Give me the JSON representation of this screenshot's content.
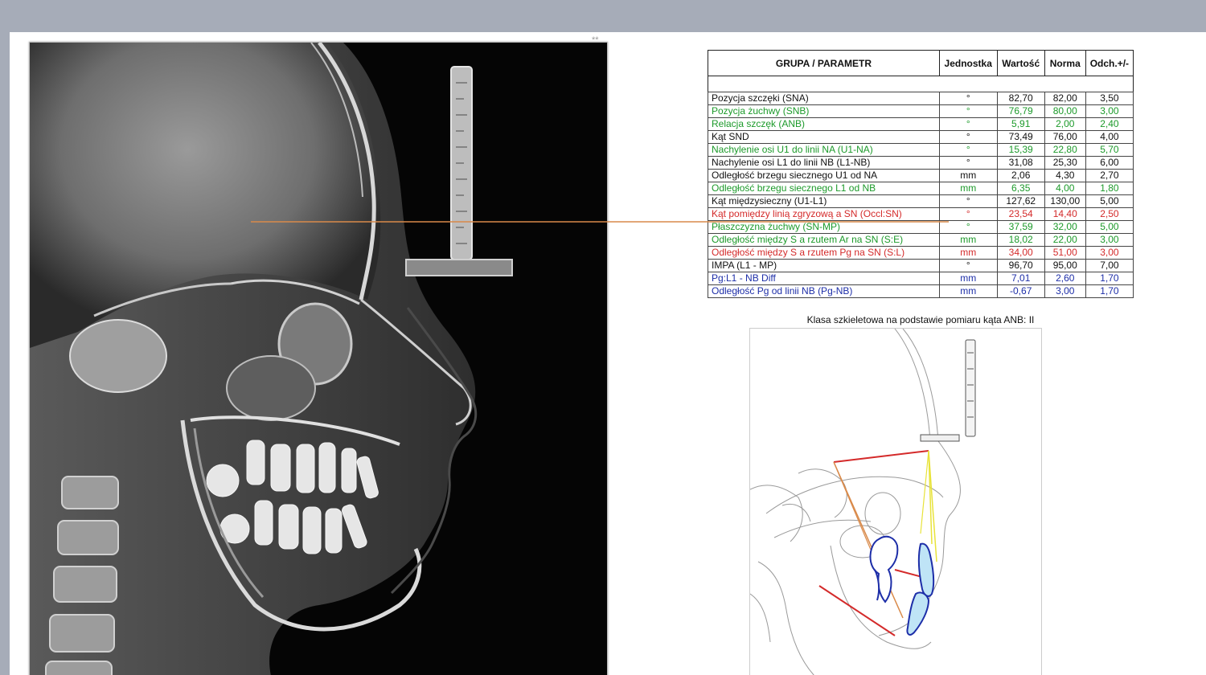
{
  "corner_mark": "**",
  "table": {
    "headers": [
      "GRUPA / PARAMETR",
      "Jednostka",
      "Wartość",
      "Norma",
      "Odch.+/-"
    ],
    "rows": [
      {
        "name": "Pozycja szczęki (SNA)",
        "unit": "°",
        "value": "82,70",
        "norm": "82,00",
        "dev": "3,50",
        "color": "black"
      },
      {
        "name": "Pozycja żuchwy (SNB)",
        "unit": "°",
        "value": "76,79",
        "norm": "80,00",
        "dev": "3,00",
        "color": "green"
      },
      {
        "name": "Relacja szczęk (ANB)",
        "unit": "°",
        "value": "5,91",
        "norm": "2,00",
        "dev": "2,40",
        "color": "green"
      },
      {
        "name": "Kąt SND",
        "unit": "°",
        "value": "73,49",
        "norm": "76,00",
        "dev": "4,00",
        "color": "black"
      },
      {
        "name": "Nachylenie osi U1 do linii NA (U1-NA)",
        "unit": "°",
        "value": "15,39",
        "norm": "22,80",
        "dev": "5,70",
        "color": "green"
      },
      {
        "name": "Nachylenie osi L1 do linii NB (L1-NB)",
        "unit": "°",
        "value": "31,08",
        "norm": "25,30",
        "dev": "6,00",
        "color": "black"
      },
      {
        "name": "Odległość brzegu siecznego U1 od NA",
        "unit": "mm",
        "value": "2,06",
        "norm": "4,30",
        "dev": "2,70",
        "color": "black"
      },
      {
        "name": "Odległość brzegu siecznego L1 od NB",
        "unit": "mm",
        "value": "6,35",
        "norm": "4,00",
        "dev": "1,80",
        "color": "green"
      },
      {
        "name": "Kąt międzysieczny (U1-L1)",
        "unit": "°",
        "value": "127,62",
        "norm": "130,00",
        "dev": "5,00",
        "color": "black"
      },
      {
        "name": "Kąt pomiędzy linią zgryzową a SN (Occl:SN)",
        "unit": "°",
        "value": "23,54",
        "norm": "14,40",
        "dev": "2,50",
        "color": "red"
      },
      {
        "name": "Płaszczyzna żuchwy (SN-MP)",
        "unit": "°",
        "value": "37,59",
        "norm": "32,00",
        "dev": "5,00",
        "color": "green"
      },
      {
        "name": "Odległość między S a rzutem Ar na SN (S:E)",
        "unit": "mm",
        "value": "18,02",
        "norm": "22,00",
        "dev": "3,00",
        "color": "green"
      },
      {
        "name": "Odległość między S a rzutem Pg na SN (S:L)",
        "unit": "mm",
        "value": "34,00",
        "norm": "51,00",
        "dev": "3,00",
        "color": "red"
      },
      {
        "name": "IMPA (L1 - MP)",
        "unit": "°",
        "value": "96,70",
        "norm": "95,00",
        "dev": "7,00",
        "color": "black"
      },
      {
        "name": "Pg:L1 - NB Diff",
        "unit": "mm",
        "value": "7,01",
        "norm": "2,60",
        "dev": "1,70",
        "color": "blue"
      },
      {
        "name": "Odległość Pg od linii NB (Pg-NB)",
        "unit": "mm",
        "value": "-0,67",
        "norm": "3,00",
        "dev": "1,70",
        "color": "blue"
      }
    ]
  },
  "caption": "Klasa szkieletowa na podstawie pomiaru kąta ANB: II",
  "colors": {
    "black": "#111111",
    "green": "#1c9a2a",
    "red": "#d42a2a",
    "blue": "#1d2ea8",
    "reference_line": "#d98a4a"
  }
}
